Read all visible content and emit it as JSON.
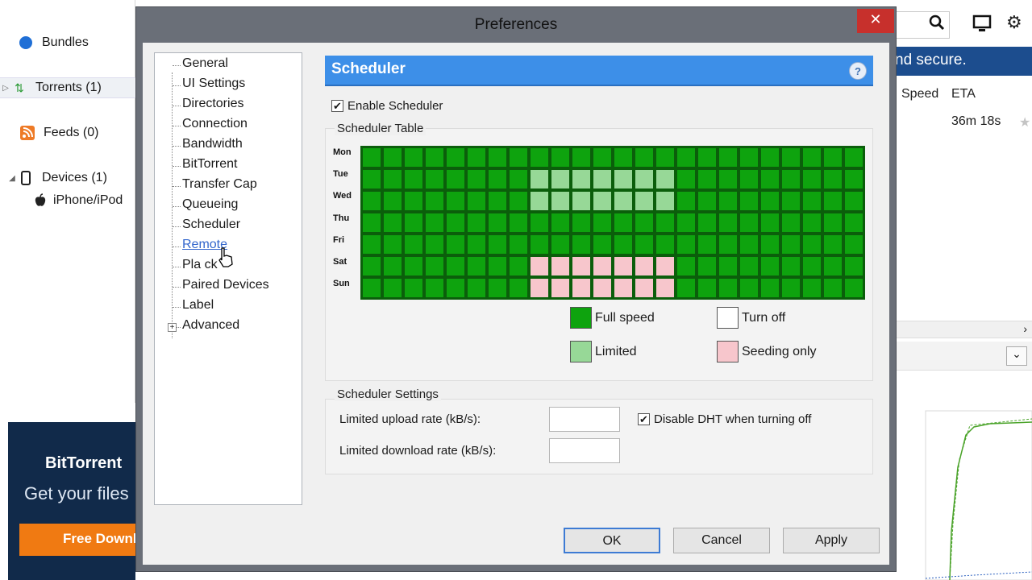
{
  "app": {
    "sidebar": {
      "bundles": "Bundles",
      "torrents": "Torrents (1)",
      "feeds": "Feeds (0)",
      "devices": "Devices (1)",
      "device_child": "iPhone/iPod"
    },
    "ad": {
      "brand": "BitTorrent",
      "tagline": "Get your files",
      "cta": "Free Downl"
    },
    "right": {
      "banner": "nd secure.",
      "col_speed": "Speed",
      "col_eta": "ETA",
      "eta_value": "36m 18s",
      "scroll_arrow": "›",
      "dropdown": "⌄"
    }
  },
  "dialog": {
    "title": "Preferences",
    "close_glyph": "✕",
    "tree": [
      "General",
      "UI Settings",
      "Directories",
      "Connection",
      "Bandwidth",
      "BitTorrent",
      "Transfer Cap",
      "Queueing",
      "Scheduler",
      "Remote",
      "Playback",
      "Paired Devices",
      "Label",
      "Advanced"
    ],
    "tree_playback_visible": "Pla      ck",
    "expander_glyph": "+",
    "scheduler": {
      "header": "Scheduler",
      "help": "?",
      "enable_label": "Enable Scheduler",
      "enable_checked": true,
      "table_label": "Scheduler Table",
      "days": [
        "Mon",
        "Tue",
        "Wed",
        "Thu",
        "Fri",
        "Sat",
        "Sun"
      ],
      "grid": [
        "FFFFFFFFFFFFFFFFFFFFFFFF",
        "FFFFFFFFLLLLLLLFFFFFFFFF",
        "FFFFFFFFLLLLLLLFFFFFFFFF",
        "FFFFFFFFFFFFFFFFFFFFFFFF",
        "FFFFFFFFFFFFFFFFFFFFFFFF",
        "FFFFFFFFSSSSSSSFFFFFFFFF",
        "FFFFFFFFSSSSSSSFFFFFFFFF"
      ],
      "legend": {
        "full": "Full speed",
        "off": "Turn off",
        "limited": "Limited",
        "seeding": "Seeding only"
      },
      "colors": {
        "full": "#0ea30e",
        "limited": "#97d897",
        "seeding": "#f7c6cc",
        "off": "#ffffff"
      },
      "settings_label": "Scheduler Settings",
      "upload_label": "Limited upload rate (kB/s):",
      "upload_value": "",
      "download_label": "Limited download rate (kB/s):",
      "download_value": "",
      "dht_label": "Disable DHT when turning off",
      "dht_checked": true
    },
    "buttons": {
      "ok": "OK",
      "cancel": "Cancel",
      "apply": "Apply"
    }
  }
}
